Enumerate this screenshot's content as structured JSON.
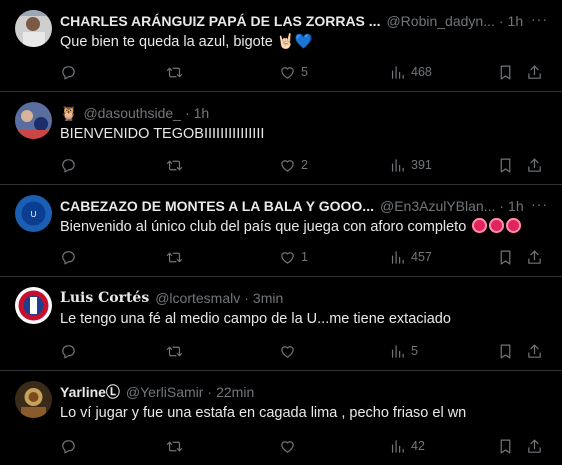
{
  "tweets": [
    {
      "name": "CHARLES ARÁNGUIZ PAPÁ DE LAS ZORRAS ...",
      "handle": "@Robin_dadyn...",
      "time": "1h",
      "text": "Que bien te queda la azul, bigote",
      "emoji": "🤘🏻💙",
      "replies": "",
      "retweets": "",
      "likes": "5",
      "views": "468"
    },
    {
      "name": "",
      "handle": "@dasouthside_",
      "time": "1h",
      "text": "BIENVENIDO TEGOBIIIIIIIIIIIIIII",
      "emoji": "",
      "replies": "",
      "retweets": "",
      "likes": "2",
      "views": "391"
    },
    {
      "name": "CABEZAZO DE MONTES A LA BALA Y GOOO...",
      "handle": "@En3AzulYBlan...",
      "time": "1h",
      "text": "Bienvenido al único club del país que juega con aforo completo",
      "emoji": "",
      "replies": "",
      "retweets": "",
      "likes": "1",
      "views": "457"
    },
    {
      "name": "Luis Cortés",
      "handle": "@lcortesmalv",
      "time": "3min",
      "text": "Le tengo una fé al medio campo de la U...me tiene extaciado",
      "emoji": "",
      "replies": "",
      "retweets": "",
      "likes": "",
      "views": "5"
    },
    {
      "name": "YarlineⓁ",
      "handle": "@YerliSamir",
      "time": "22min",
      "text": "Lo ví jugar y fue una estafa en cagada lima , pecho friaso el wn",
      "emoji": "",
      "replies": "",
      "retweets": "",
      "likes": "",
      "views": "42"
    }
  ],
  "icons": {
    "reply": "reply-icon",
    "retweet": "retweet-icon",
    "like": "heart-icon",
    "views": "views-icon",
    "bookmark": "bookmark-icon",
    "share": "share-icon"
  },
  "colors": {
    "background": "#000000",
    "text": "#e7e9ea",
    "muted": "#71767b",
    "border": "#2f3336"
  }
}
